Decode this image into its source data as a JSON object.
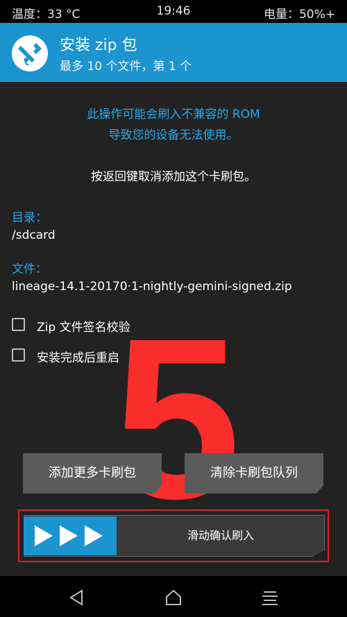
{
  "status_bar": {
    "temperature": "温度：33 °C",
    "time": "19:46",
    "battery": "电量：50%+"
  },
  "header": {
    "title": "安装 zip 包",
    "subtitle": "最多 10 个文件，第 1 个",
    "logo_icon": "twrp-logo-icon"
  },
  "warning": {
    "line1": "此操作可能会刷入不兼容的 ROM",
    "line2": "导致您的设备无法使用。"
  },
  "info": "按返回键取消添加这个卡刷包。",
  "directory": {
    "label": "目录：",
    "value": "/sdcard"
  },
  "file": {
    "label": "文件：",
    "value": "lineage-14.1-20170·1-nightly-gemini-signed.zip"
  },
  "options": [
    {
      "label": "Zip 文件签名校验",
      "checked": false
    },
    {
      "label": "安装完成后重启",
      "checked": false
    }
  ],
  "overlay_number": "5",
  "buttons": {
    "add": "添加更多卡刷包",
    "clear": "清除卡刷包队列"
  },
  "swipe": {
    "label": "滑动确认刷入"
  },
  "colors": {
    "accent": "#1b94cf",
    "warning_text": "#28a8ec",
    "overlay": "#fa2d2d",
    "highlight_border": "#e3202a"
  },
  "nav": {
    "back_icon": "back-triangle-icon",
    "home_icon": "home-icon",
    "menu_icon": "menu-icon"
  }
}
